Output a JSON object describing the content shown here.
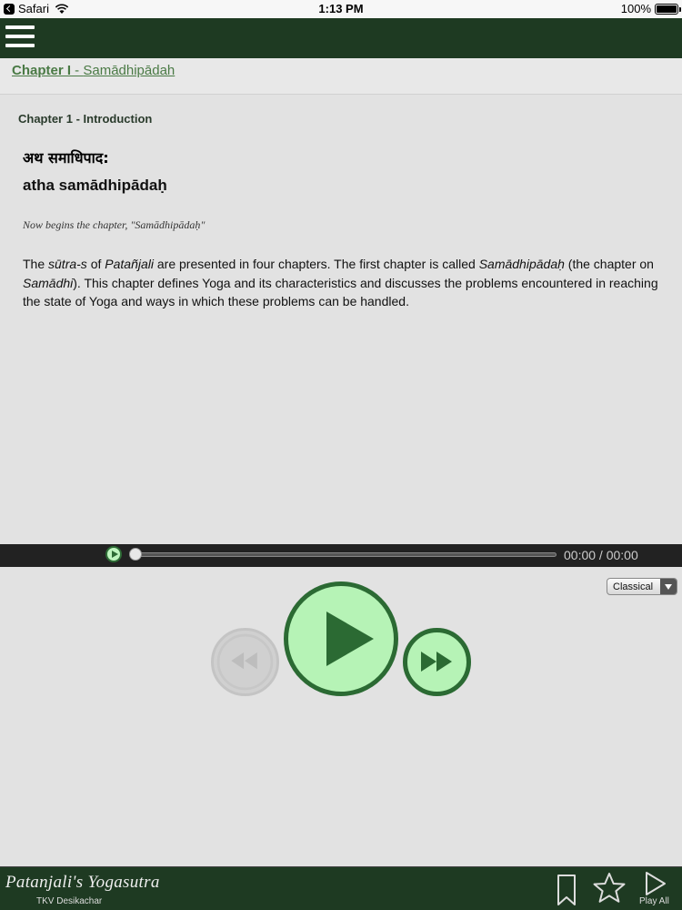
{
  "status_bar": {
    "back_app": "Safari",
    "time": "1:13 PM",
    "battery": "100%"
  },
  "nav": {
    "menu_icon": "hamburger-menu-icon"
  },
  "chapter": {
    "number_label": "Chapter I",
    "separator": " - ",
    "name": "Samādhipādah"
  },
  "content": {
    "section_title": "Chapter 1 - Introduction",
    "sanskrit": "अथ समाधिपाद:",
    "transliteration": "atha samādhipādaḥ",
    "translation": "Now begins the chapter, \"Samādhipādaḥ\"",
    "body": {
      "t1": "The ",
      "i1": "sūtra-s",
      "t2": " of ",
      "i2": "Patañjali",
      "t3": " are presented in four chapters. The first chapter is called ",
      "i3": "Samādhipādaḥ",
      "t4": " (the chapter on ",
      "i4": "Samādhi",
      "t5": "). This chapter defines Yoga and its characteristics and discusses the problems encountered in reaching the state of Yoga and ways in which these problems can be handled."
    }
  },
  "audio": {
    "time_readout": "00:00 / 00:00",
    "progress": 0,
    "style_options_selected": "Classical",
    "controls": {
      "rewind_icon": "rewind-icon",
      "play_icon": "play-icon",
      "fast_forward_icon": "fast-forward-icon"
    },
    "rewind_enabled": false
  },
  "footer": {
    "brand_title": "Patanjali's Yogasutra",
    "brand_author": "TKV Desikachar",
    "bookmark_icon": "bookmark-icon",
    "favorite_icon": "star-icon",
    "play_all_label": "Play All"
  },
  "colors": {
    "nav_bg": "#1e3a22",
    "accent_green": "#2b6a33",
    "button_fill": "#b6f3b6",
    "link_green": "#4a7a45",
    "content_bg": "#e2e2e2"
  }
}
